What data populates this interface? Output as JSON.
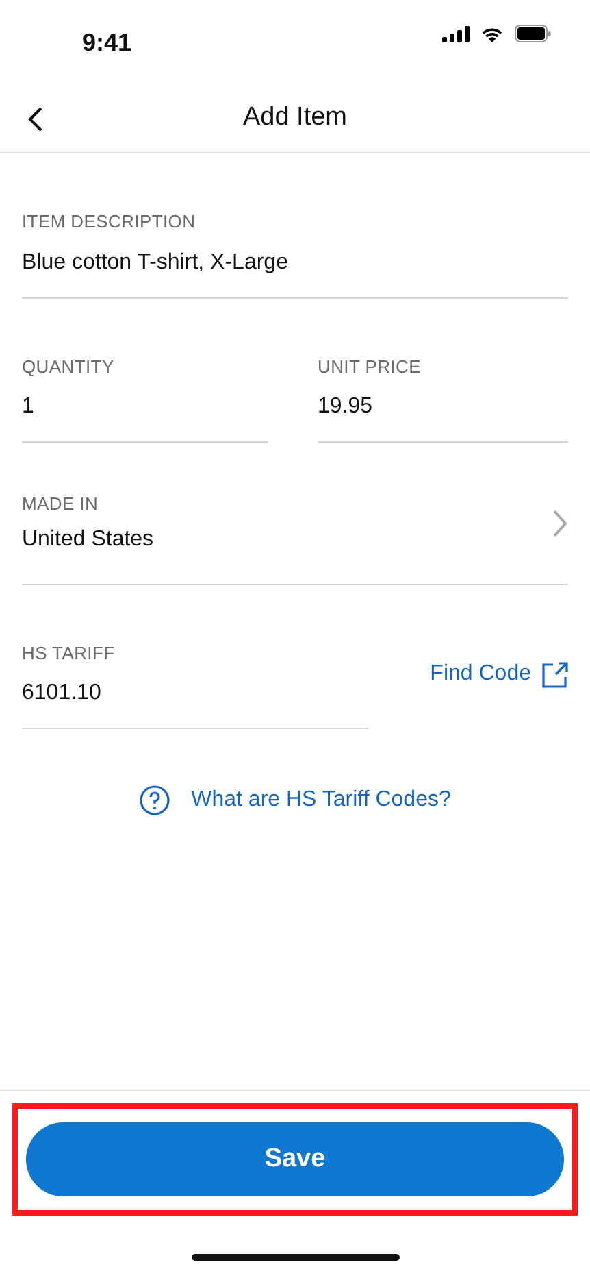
{
  "status_bar": {
    "time": "9:41"
  },
  "header": {
    "title": "Add Item"
  },
  "item_description": {
    "label": "ITEM DESCRIPTION",
    "value": "Blue cotton T-shirt, X-Large"
  },
  "quantity": {
    "label": "QUANTITY",
    "value": "1"
  },
  "unit_price": {
    "label": "UNIT PRICE",
    "value": "19.95"
  },
  "made_in": {
    "label": "MADE IN",
    "value": "United States"
  },
  "hs_tariff": {
    "label": "HS TARIFF",
    "value": "6101.10",
    "link": "Find Code"
  },
  "help_link": {
    "label": "What are HS Tariff Codes?"
  },
  "save_button": {
    "label": "Save",
    "highlighted": true
  }
}
